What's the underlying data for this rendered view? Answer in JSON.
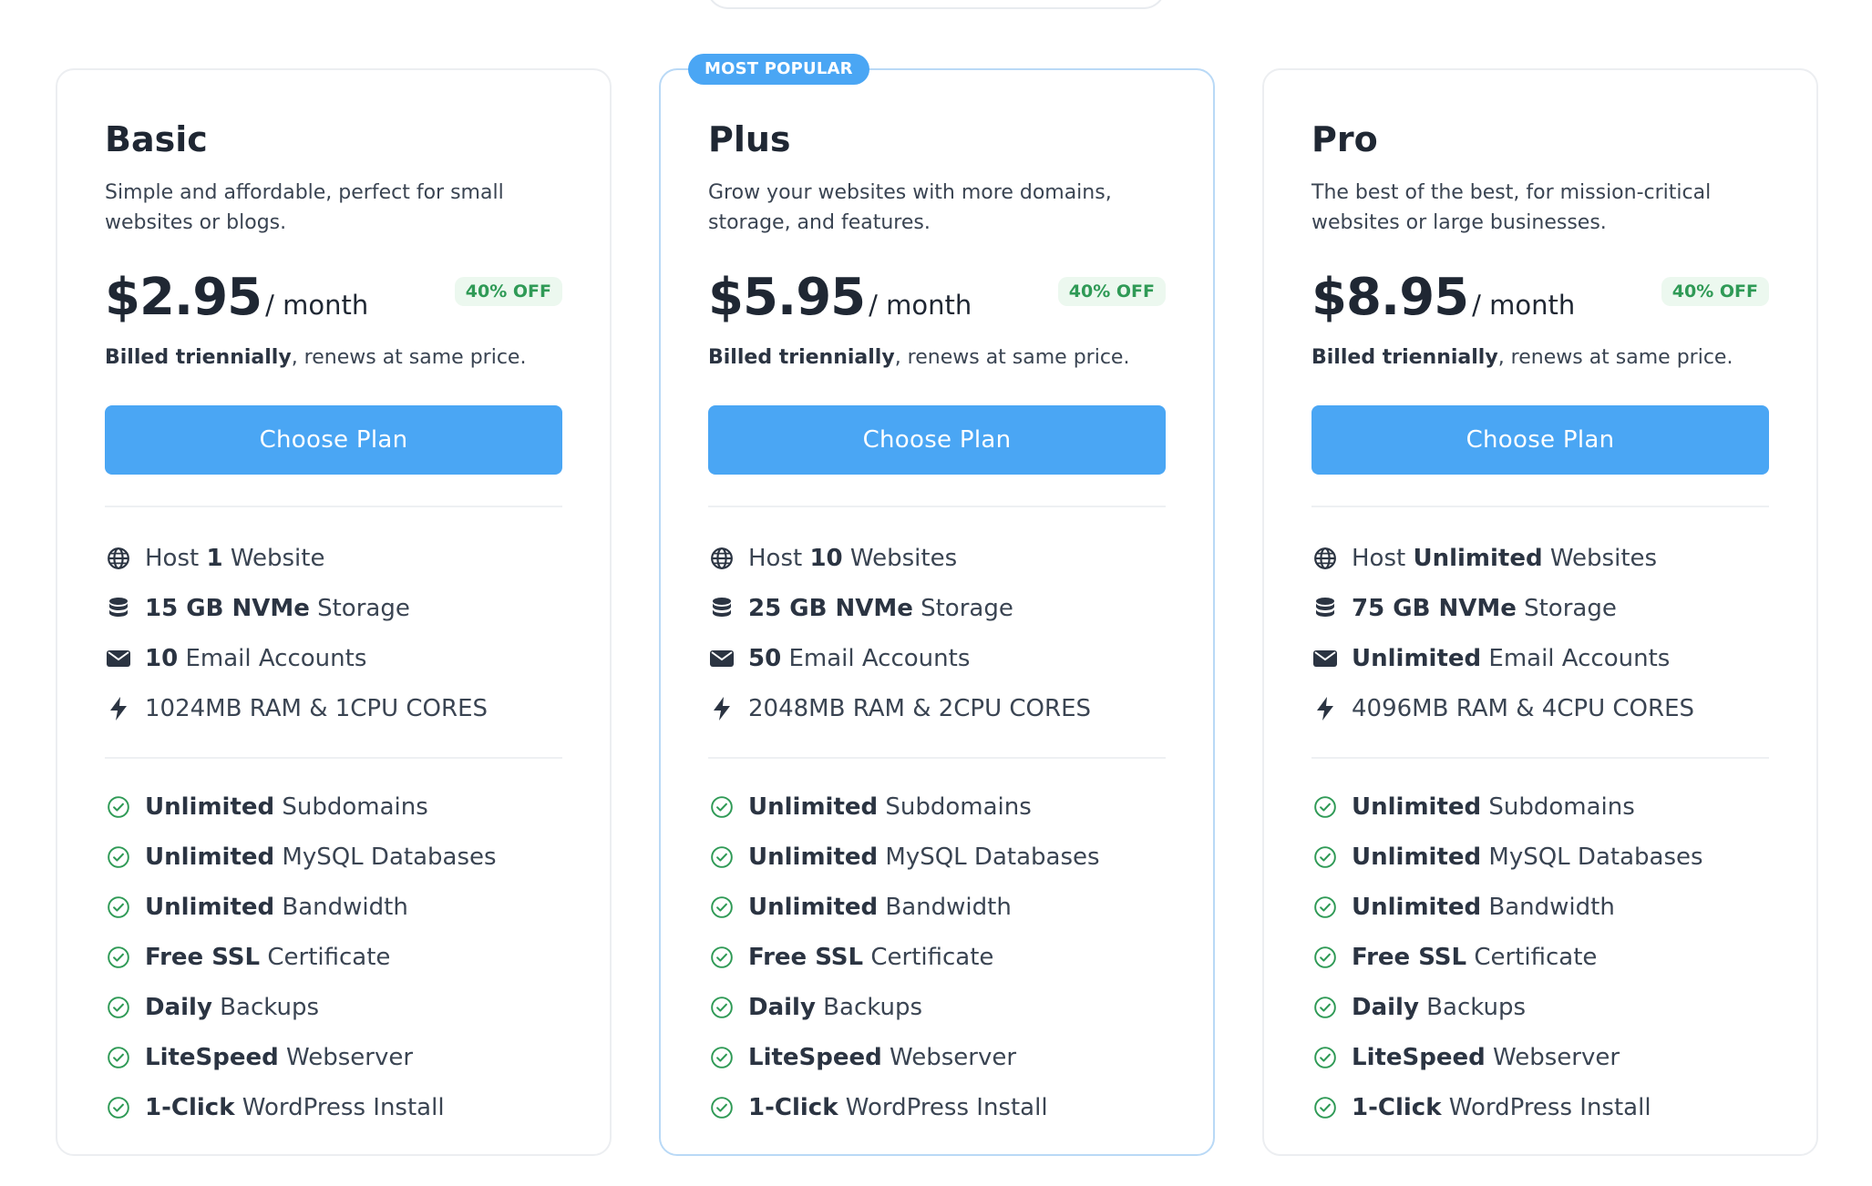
{
  "plans": [
    {
      "name": "Basic",
      "featured": false,
      "badge": "",
      "description": "Simple and affordable, perfect for small websites or blogs.",
      "price": "$2.95",
      "per": "/ month",
      "discount": "40% OFF",
      "billing_bold": "Billed triennially",
      "billing_rest": ", renews at same price.",
      "button": "Choose Plan",
      "specs": [
        {
          "icon": "globe-icon",
          "pre": "Host ",
          "bold": "1",
          "post": " Website"
        },
        {
          "icon": "database-icon",
          "pre": "",
          "bold": "15 GB NVMe",
          "post": " Storage"
        },
        {
          "icon": "envelope-icon",
          "pre": "",
          "bold": "10",
          "post": " Email Accounts"
        },
        {
          "icon": "bolt-icon",
          "pre": "1024MB RAM & 1CPU CORES",
          "bold": "",
          "post": ""
        }
      ],
      "features": [
        {
          "bold": "Unlimited",
          "post": " Subdomains"
        },
        {
          "bold": "Unlimited",
          "post": " MySQL Databases"
        },
        {
          "bold": "Unlimited",
          "post": " Bandwidth"
        },
        {
          "bold": "Free SSL",
          "post": " Certificate"
        },
        {
          "bold": "Daily",
          "post": " Backups"
        },
        {
          "bold": "LiteSpeed",
          "post": " Webserver"
        },
        {
          "bold": "1-Click",
          "post": " WordPress Install"
        }
      ]
    },
    {
      "name": "Plus",
      "featured": true,
      "badge": "MOST POPULAR",
      "description": "Grow your websites with more domains, storage, and features.",
      "price": "$5.95",
      "per": "/ month",
      "discount": "40% OFF",
      "billing_bold": "Billed triennially",
      "billing_rest": ", renews at same price.",
      "button": "Choose Plan",
      "specs": [
        {
          "icon": "globe-icon",
          "pre": "Host ",
          "bold": "10",
          "post": " Websites"
        },
        {
          "icon": "database-icon",
          "pre": "",
          "bold": "25 GB NVMe",
          "post": " Storage"
        },
        {
          "icon": "envelope-icon",
          "pre": "",
          "bold": "50",
          "post": " Email Accounts"
        },
        {
          "icon": "bolt-icon",
          "pre": "2048MB RAM & 2CPU CORES",
          "bold": "",
          "post": ""
        }
      ],
      "features": [
        {
          "bold": "Unlimited",
          "post": " Subdomains"
        },
        {
          "bold": "Unlimited",
          "post": " MySQL Databases"
        },
        {
          "bold": "Unlimited",
          "post": " Bandwidth"
        },
        {
          "bold": "Free SSL",
          "post": " Certificate"
        },
        {
          "bold": "Daily",
          "post": " Backups"
        },
        {
          "bold": "LiteSpeed",
          "post": " Webserver"
        },
        {
          "bold": "1-Click",
          "post": " WordPress Install"
        }
      ]
    },
    {
      "name": "Pro",
      "featured": false,
      "badge": "",
      "description": "The best of the best, for mission-critical websites or large businesses.",
      "price": "$8.95",
      "per": "/ month",
      "discount": "40% OFF",
      "billing_bold": "Billed triennially",
      "billing_rest": ", renews at same price.",
      "button": "Choose Plan",
      "specs": [
        {
          "icon": "globe-icon",
          "pre": "Host ",
          "bold": "Unlimited",
          "post": " Websites"
        },
        {
          "icon": "database-icon",
          "pre": "",
          "bold": "75 GB NVMe",
          "post": " Storage"
        },
        {
          "icon": "envelope-icon",
          "pre": "",
          "bold": "Unlimited",
          "post": " Email Accounts"
        },
        {
          "icon": "bolt-icon",
          "pre": "4096MB RAM & 4CPU CORES",
          "bold": "",
          "post": ""
        }
      ],
      "features": [
        {
          "bold": "Unlimited",
          "post": " Subdomains"
        },
        {
          "bold": "Unlimited",
          "post": " MySQL Databases"
        },
        {
          "bold": "Unlimited",
          "post": " Bandwidth"
        },
        {
          "bold": "Free SSL",
          "post": " Certificate"
        },
        {
          "bold": "Daily",
          "post": " Backups"
        },
        {
          "bold": "LiteSpeed",
          "post": " Webserver"
        },
        {
          "bold": "1-Click",
          "post": " WordPress Install"
        }
      ]
    }
  ],
  "colors": {
    "accent": "#4aa6f4",
    "discount_bg": "#ecf8ef",
    "discount_text": "#2f9a56",
    "check": "#2f9a56",
    "text_dark": "#1f2733",
    "icon": "#2b3442"
  }
}
